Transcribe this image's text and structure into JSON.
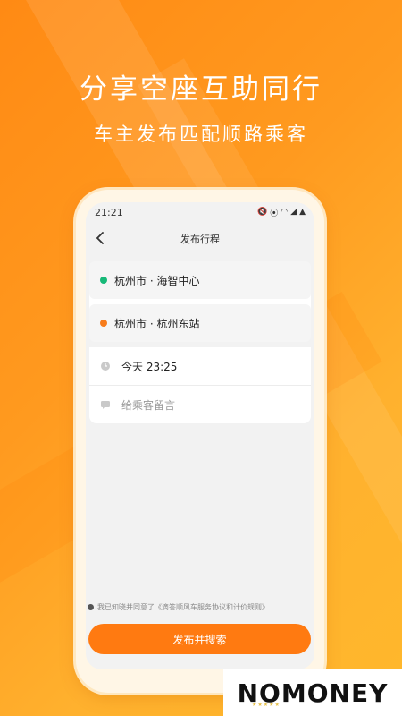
{
  "promo": {
    "headline": "分享空座互助同行",
    "subline": "车主发布匹配顺路乘客"
  },
  "status_bar": {
    "time": "21:21",
    "icons": [
      "mute-icon",
      "location-icon",
      "wifi-icon",
      "signal-icon",
      "person-icon"
    ]
  },
  "nav": {
    "title": "发布行程",
    "back_icon": "chevron-left-icon"
  },
  "trip": {
    "origin": "杭州市 · 海智中心",
    "destination": "杭州市 · 杭州东站",
    "time": "今天 23:25",
    "message_placeholder": "给乘客留言"
  },
  "agreement": {
    "text": "我已知晓并同意了《滴答顺风车服务协议和计价规则》"
  },
  "actions": {
    "submit_label": "发布并搜索"
  },
  "brand": {
    "logo_text": "NOMONEY"
  },
  "colors": {
    "primary": "#ff7a11",
    "origin_dot": "#17b978",
    "destination_dot": "#f77c1b"
  }
}
